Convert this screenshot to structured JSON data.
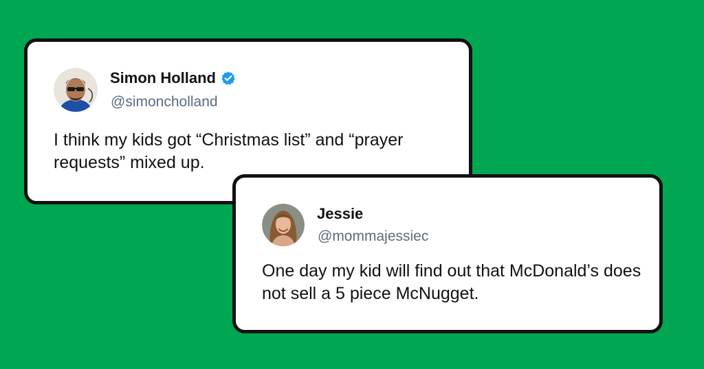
{
  "colors": {
    "background": "#00A651",
    "card": "#FFFFFF",
    "border": "#111111",
    "verified": "#1D9BF0",
    "handle": "#5B6B7B"
  },
  "tweets": [
    {
      "name": "Simon Holland",
      "verified": true,
      "verified_icon": "verified-badge-icon",
      "handle": "@simoncholland",
      "text": "I think my kids got “Christmas list” and “prayer requests” mixed up."
    },
    {
      "name": "Jessie",
      "verified": false,
      "handle": "@mommajessiec",
      "text": "One day my kid will find out that McDonald’s does not sell a 5 piece McNugget."
    }
  ]
}
